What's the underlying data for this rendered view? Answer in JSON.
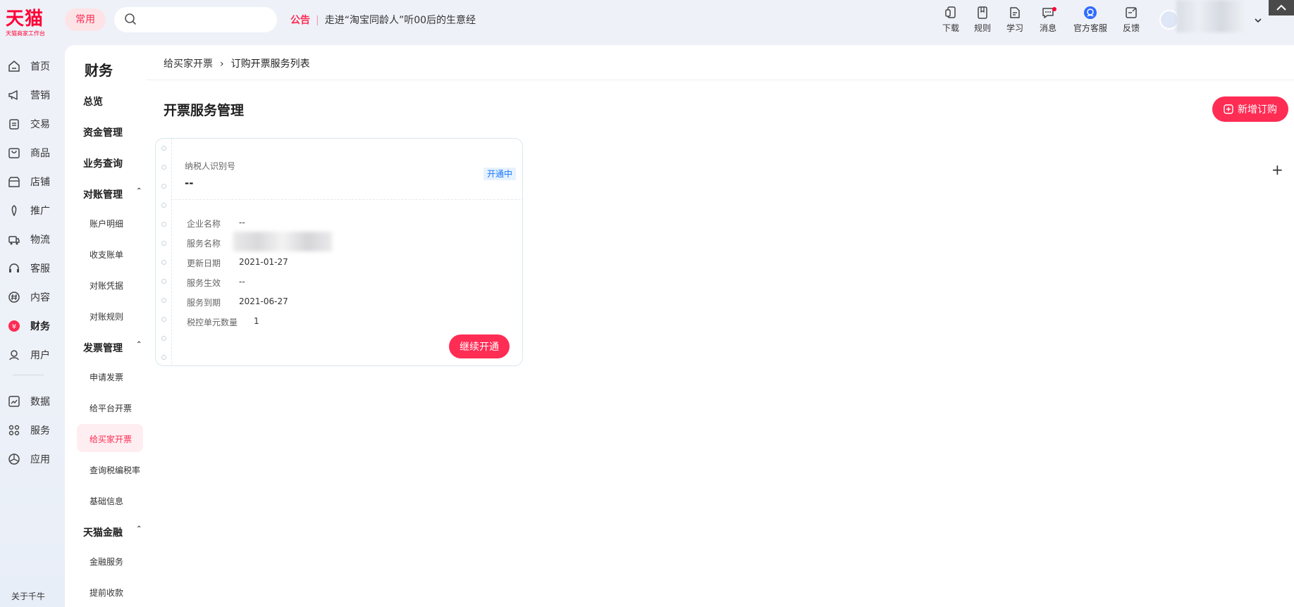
{
  "brand": {
    "name": "天猫",
    "subtitle": "天猫商家工作台",
    "accent": "#ff2c54"
  },
  "topbar": {
    "favorites_label": "常用",
    "search_placeholder": "",
    "announcement": {
      "tag": "公告",
      "text": "走进“淘宝同龄人”听00后的生意经"
    },
    "tools": [
      {
        "label": "下载",
        "icon": "download-icon",
        "has_dot": false
      },
      {
        "label": "规则",
        "icon": "rules-icon",
        "has_dot": false
      },
      {
        "label": "学习",
        "icon": "learn-icon",
        "has_dot": false
      },
      {
        "label": "消息",
        "icon": "message-icon",
        "has_dot": true
      },
      {
        "label": "官方客服",
        "icon": "customer-service-icon",
        "has_dot": false
      },
      {
        "label": "反馈",
        "icon": "feedback-icon",
        "has_dot": false
      }
    ]
  },
  "rail": {
    "items": [
      {
        "label": "首页",
        "icon": "home-icon"
      },
      {
        "label": "营销",
        "icon": "megaphone-icon"
      },
      {
        "label": "交易",
        "icon": "trade-icon"
      },
      {
        "label": "商品",
        "icon": "product-icon"
      },
      {
        "label": "店铺",
        "icon": "store-icon"
      },
      {
        "label": "推广",
        "icon": "promote-icon"
      },
      {
        "label": "物流",
        "icon": "logistics-icon"
      },
      {
        "label": "客服",
        "icon": "headset-icon"
      },
      {
        "label": "内容",
        "icon": "content-icon"
      },
      {
        "label": "财务",
        "icon": "finance-icon",
        "active": true
      },
      {
        "label": "用户",
        "icon": "user-icon"
      },
      {
        "label": "数据",
        "icon": "data-icon"
      },
      {
        "label": "服务",
        "icon": "service-icon"
      },
      {
        "label": "应用",
        "icon": "app-icon"
      }
    ],
    "footer": "关于千牛"
  },
  "subnav": {
    "title": "财务",
    "items": [
      {
        "type": "group",
        "label": "总览"
      },
      {
        "type": "group",
        "label": "资金管理"
      },
      {
        "type": "group",
        "label": "业务查询"
      },
      {
        "type": "group",
        "label": "对账管理",
        "expanded": true
      },
      {
        "type": "sub",
        "label": "账户明细"
      },
      {
        "type": "sub",
        "label": "收支账单"
      },
      {
        "type": "sub",
        "label": "对账凭据"
      },
      {
        "type": "sub",
        "label": "对账规则"
      },
      {
        "type": "group",
        "label": "发票管理",
        "expanded": true
      },
      {
        "type": "sub",
        "label": "申请发票"
      },
      {
        "type": "sub",
        "label": "给平台开票"
      },
      {
        "type": "sub",
        "label": "给买家开票",
        "active": true
      },
      {
        "type": "sub",
        "label": "查询税编税率"
      },
      {
        "type": "sub",
        "label": "基础信息"
      },
      {
        "type": "group",
        "label": "天猫金融",
        "expanded": true
      },
      {
        "type": "sub",
        "label": "金融服务"
      },
      {
        "type": "sub",
        "label": "提前收款"
      }
    ],
    "expanded_arrow": "⌃"
  },
  "main": {
    "breadcrumb": [
      "给买家开票",
      "订购开票服务列表"
    ],
    "page_title": "开票服务管理",
    "new_order_label": "新增订购",
    "plus_label": "+"
  },
  "card": {
    "taxpayer_id_label": "纳税人识别号",
    "taxpayer_id_value": "--",
    "status": "开通中",
    "fields": [
      {
        "key": "企业名称",
        "value": "--"
      },
      {
        "key": "服务名称",
        "value": ""
      },
      {
        "key": "更新日期",
        "value": "2021-01-27"
      },
      {
        "key": "服务生效",
        "value": "--"
      },
      {
        "key": "服务到期",
        "value": "2021-06-27"
      },
      {
        "key": "税控单元数量",
        "value": "1"
      }
    ],
    "continue_label": "继续开通"
  }
}
